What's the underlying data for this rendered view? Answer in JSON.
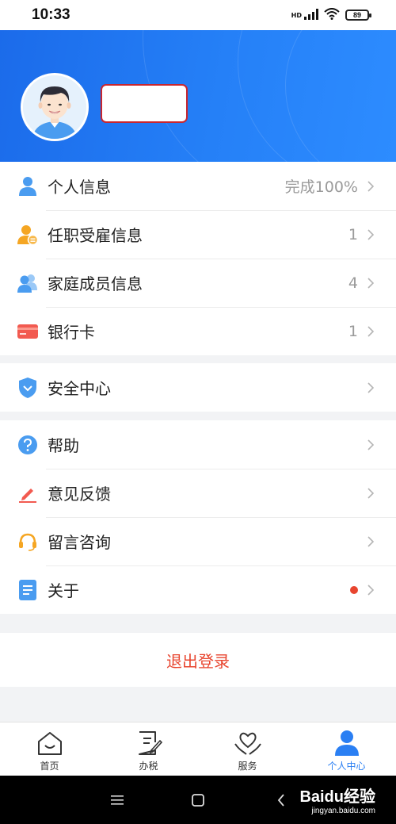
{
  "status_bar": {
    "time": "10:33",
    "network_badge": "HD",
    "battery": "89"
  },
  "menu_group_1": [
    {
      "label": "个人信息",
      "value": "完成100%",
      "icon": "person-icon"
    },
    {
      "label": "任职受雇信息",
      "value": "1",
      "icon": "employment-icon"
    },
    {
      "label": "家庭成员信息",
      "value": "4",
      "icon": "family-icon"
    },
    {
      "label": "银行卡",
      "value": "1",
      "icon": "bank-card-icon"
    }
  ],
  "menu_group_2": [
    {
      "label": "安全中心",
      "icon": "shield-icon"
    }
  ],
  "menu_group_3": [
    {
      "label": "帮助",
      "icon": "help-icon"
    },
    {
      "label": "意见反馈",
      "icon": "pen-icon"
    },
    {
      "label": "留言咨询",
      "icon": "headset-icon"
    },
    {
      "label": "关于",
      "icon": "document-icon",
      "has_new_dot": true
    }
  ],
  "logout_label": "退出登录",
  "tabs": [
    {
      "label": "首页",
      "icon": "home-icon"
    },
    {
      "label": "办税",
      "icon": "tax-form-icon"
    },
    {
      "label": "服务",
      "icon": "heart-hands-icon"
    },
    {
      "label": "个人中心",
      "icon": "person-filled-icon",
      "active": true
    }
  ],
  "watermark": {
    "main": "Baidu经验",
    "sub": "jingyan.baidu.com"
  },
  "colors": {
    "header_blue": "#1b6bea",
    "accent": "#2a7ff3",
    "danger": "#e8452f"
  }
}
